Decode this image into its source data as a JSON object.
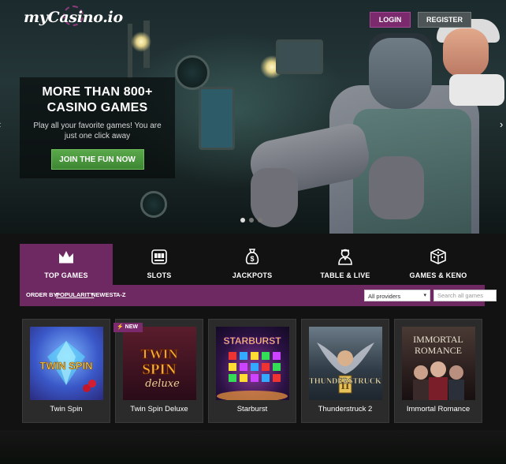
{
  "header": {
    "logo_text": "myCasino.io",
    "login_label": "LOGIN",
    "register_label": "REGISTER"
  },
  "hero": {
    "title_line1": "MORE THAN 800+",
    "title_line2": "CASINO GAMES",
    "subtitle": "Play all your favorite games! You are just one click away",
    "cta_label": "JOIN THE FUN NOW",
    "slide_count": 3,
    "active_slide": 1
  },
  "tabs": [
    {
      "label": "TOP GAMES",
      "icon": "crown-icon",
      "active": true
    },
    {
      "label": "SLOTS",
      "icon": "slot-machine-icon",
      "active": false
    },
    {
      "label": "JACKPOTS",
      "icon": "money-bag-icon",
      "active": false
    },
    {
      "label": "TABLE & LIVE",
      "icon": "dealer-icon",
      "active": false
    },
    {
      "label": "GAMES & KENO",
      "icon": "dice-icon",
      "active": false
    }
  ],
  "filters": {
    "order_by_label": "ORDER BY:",
    "options": [
      "POPULARITY",
      "NEWEST",
      "A-Z"
    ],
    "selected": "POPULARITY",
    "provider_value": "All providers",
    "search_placeholder": "Search all games"
  },
  "games": [
    {
      "name": "Twin Spin",
      "art_text": "TWIN SPIN",
      "badge": ""
    },
    {
      "name": "Twin Spin Deluxe",
      "art_text": "TWIN SPIN deluxe",
      "badge": "NEW"
    },
    {
      "name": "Starburst",
      "art_text": "STARBURST",
      "badge": ""
    },
    {
      "name": "Thunderstruck 2",
      "art_text": "THUNDERSTRUCK",
      "badge": ""
    },
    {
      "name": "Immortal Romance",
      "art_text": "IMMORTAL ROMANCE",
      "badge": ""
    }
  ],
  "colors": {
    "accent_purple": "#6e2862",
    "cta_green": "#4a9a3e",
    "register_grey": "#4e5556"
  }
}
